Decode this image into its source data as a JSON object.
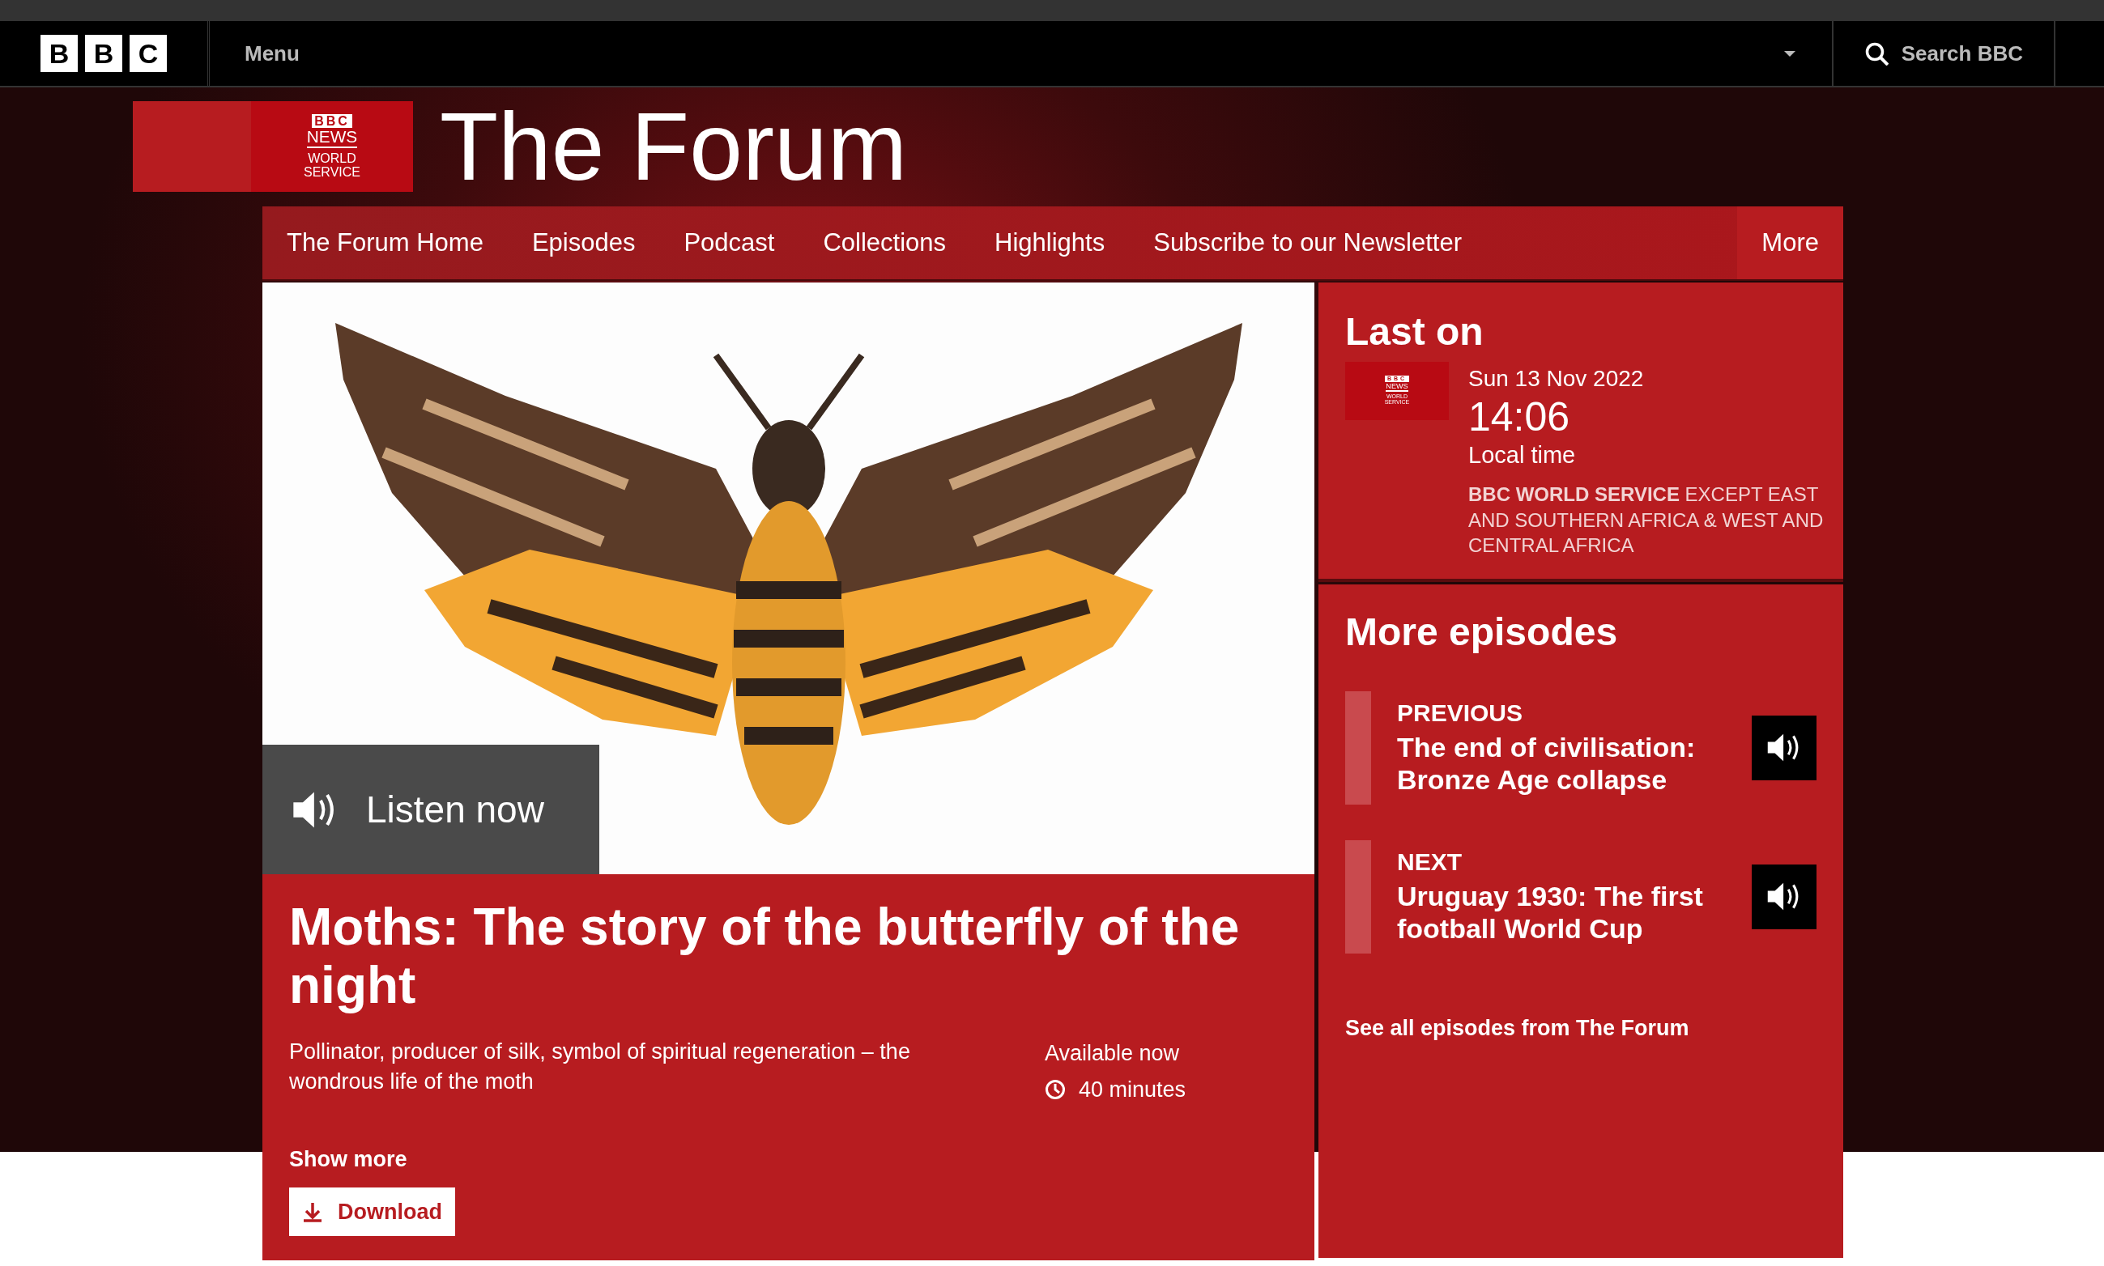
{
  "top_bar": {
    "logo_letters": [
      "B",
      "B",
      "C"
    ],
    "menu": "Menu",
    "search": "Search BBC"
  },
  "brand": {
    "logo": {
      "bbc": "BBC",
      "news": "NEWS",
      "service": "WORLD SERVICE"
    },
    "title": "The Forum"
  },
  "nav": {
    "items": [
      "The Forum Home",
      "Episodes",
      "Podcast",
      "Collections",
      "Highlights",
      "Subscribe to our Newsletter"
    ],
    "more": "More"
  },
  "episode": {
    "listen": "Listen now",
    "title": "Moths: The story of the butterfly of the night",
    "description": "Pollinator, producer of silk, symbol of spiritual regeneration – the wondrous life of the moth",
    "availability": "Available now",
    "duration": "40 minutes",
    "show_more": "Show more",
    "download": "Download"
  },
  "last_on": {
    "heading": "Last on",
    "logo": {
      "bbc": "BBC",
      "news": "NEWS",
      "service": "WORLD SERVICE"
    },
    "date": "Sun 13 Nov 2022",
    "time": "14:06",
    "time_note": "Local time",
    "channel": "**BBC WORLD SERVICE** EXCEPT EAST AND SOUTHERN AFRICA & WEST AND CENTRAL AFRICA"
  },
  "more_episodes": {
    "heading": "More episodes",
    "items": [
      {
        "label": "PREVIOUS",
        "title": "The end of civilisation: Bronze Age collapse"
      },
      {
        "label": "NEXT",
        "title": "Uruguay 1930: The first football World Cup"
      }
    ],
    "see_all": "See all episodes from The Forum"
  }
}
